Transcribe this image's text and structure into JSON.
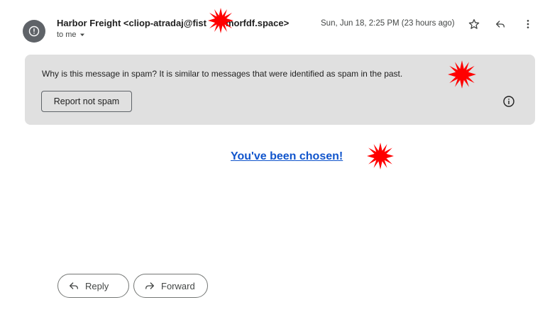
{
  "header": {
    "sender": "Harbor Freight <cliop-atradaj@fist",
    "sender_tail": "morfdf.space>",
    "recipient": "to me",
    "date": "Sun, Jun 18, 2:25 PM (23 hours ago)"
  },
  "spam_banner": {
    "message": "Why is this message in spam? It is similar to messages that were identified as spam in the past.",
    "report_button": "Report not spam"
  },
  "body": {
    "link_text": "You've been chosen!"
  },
  "actions": {
    "reply": "Reply",
    "forward": "Forward"
  },
  "icons": [
    "alert-icon",
    "caret-down-icon",
    "star-icon",
    "reply-icon",
    "more-vert-icon",
    "info-icon",
    "redaction-burst"
  ],
  "colors": {
    "banner_bg": "#e0e0e0",
    "link": "#1155cc",
    "avatar": "#5f6368",
    "redaction": "#ff0000"
  }
}
